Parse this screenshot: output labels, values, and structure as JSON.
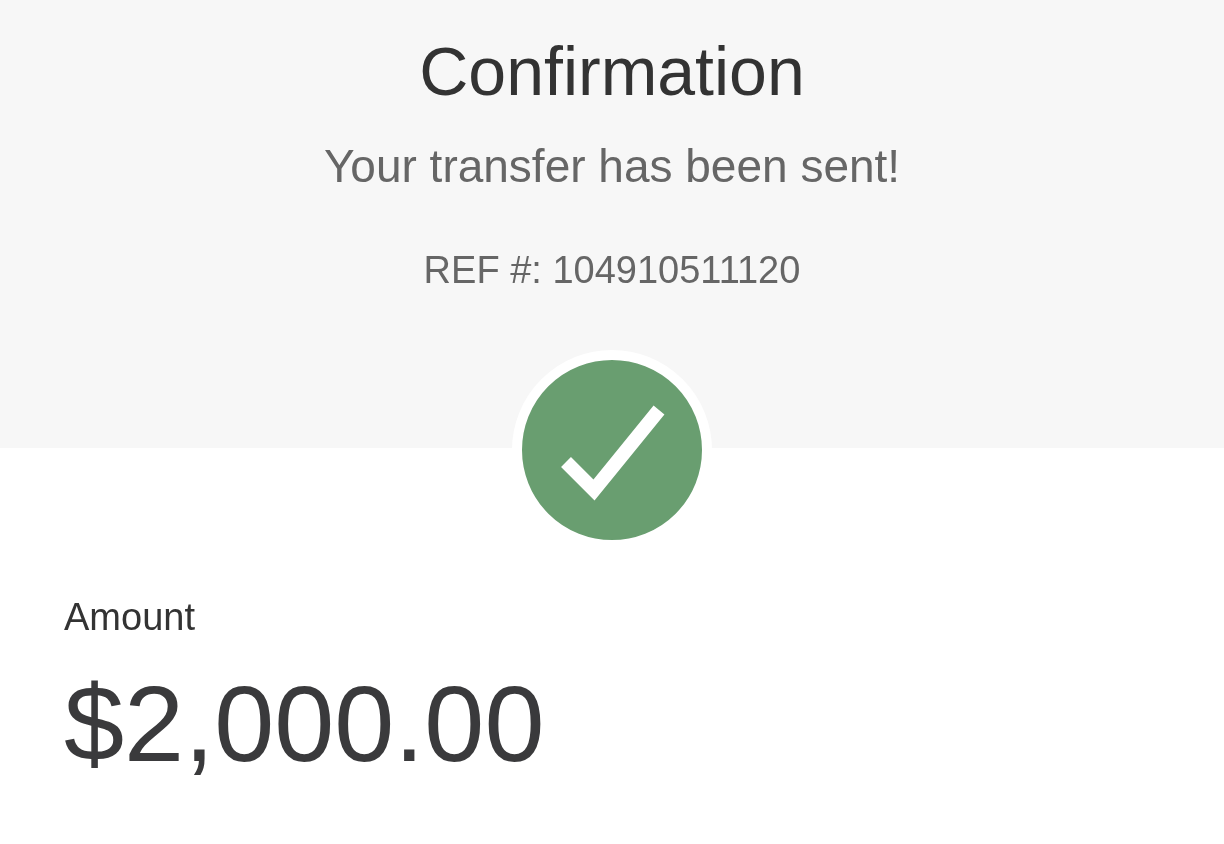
{
  "header": {
    "title": "Confirmation",
    "message": "Your transfer has been sent!",
    "reference": "REF #: 104910511120"
  },
  "amount": {
    "label": "Amount",
    "value": "$2,000.00"
  }
}
